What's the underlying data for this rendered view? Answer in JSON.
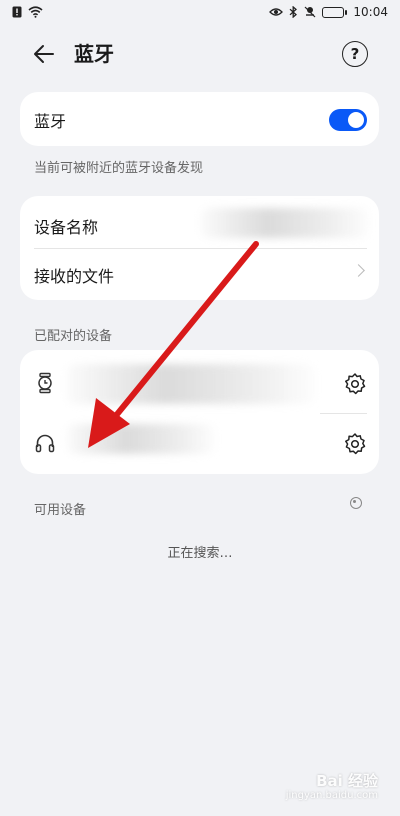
{
  "status_bar": {
    "time": "10:04",
    "left_icons": [
      "alert-sim-icon",
      "wifi-icon"
    ],
    "right_icons": [
      "eye-icon",
      "bluetooth-icon",
      "mute-icon",
      "battery-icon"
    ]
  },
  "header": {
    "title": "蓝牙",
    "back_icon": "arrow-left-icon",
    "help_icon": "question-circle-icon",
    "help_glyph": "?"
  },
  "bluetooth": {
    "label": "蓝牙",
    "enabled": true,
    "accent": "#0a59f7"
  },
  "visibility_note": "当前可被附近的蓝牙设备发现",
  "device_card": {
    "name_label": "设备名称",
    "files_label": "接收的文件"
  },
  "paired": {
    "section_title": "已配对的设备",
    "devices": [
      {
        "icon": "watch-icon",
        "settings_icon": "gear-icon"
      },
      {
        "icon": "headphones-icon",
        "settings_icon": "gear-icon"
      }
    ]
  },
  "available": {
    "section_title": "可用设备",
    "status": "正在搜索…"
  },
  "watermark": {
    "text": "Bai 经验",
    "sub": "jingyan.baidu.com"
  }
}
